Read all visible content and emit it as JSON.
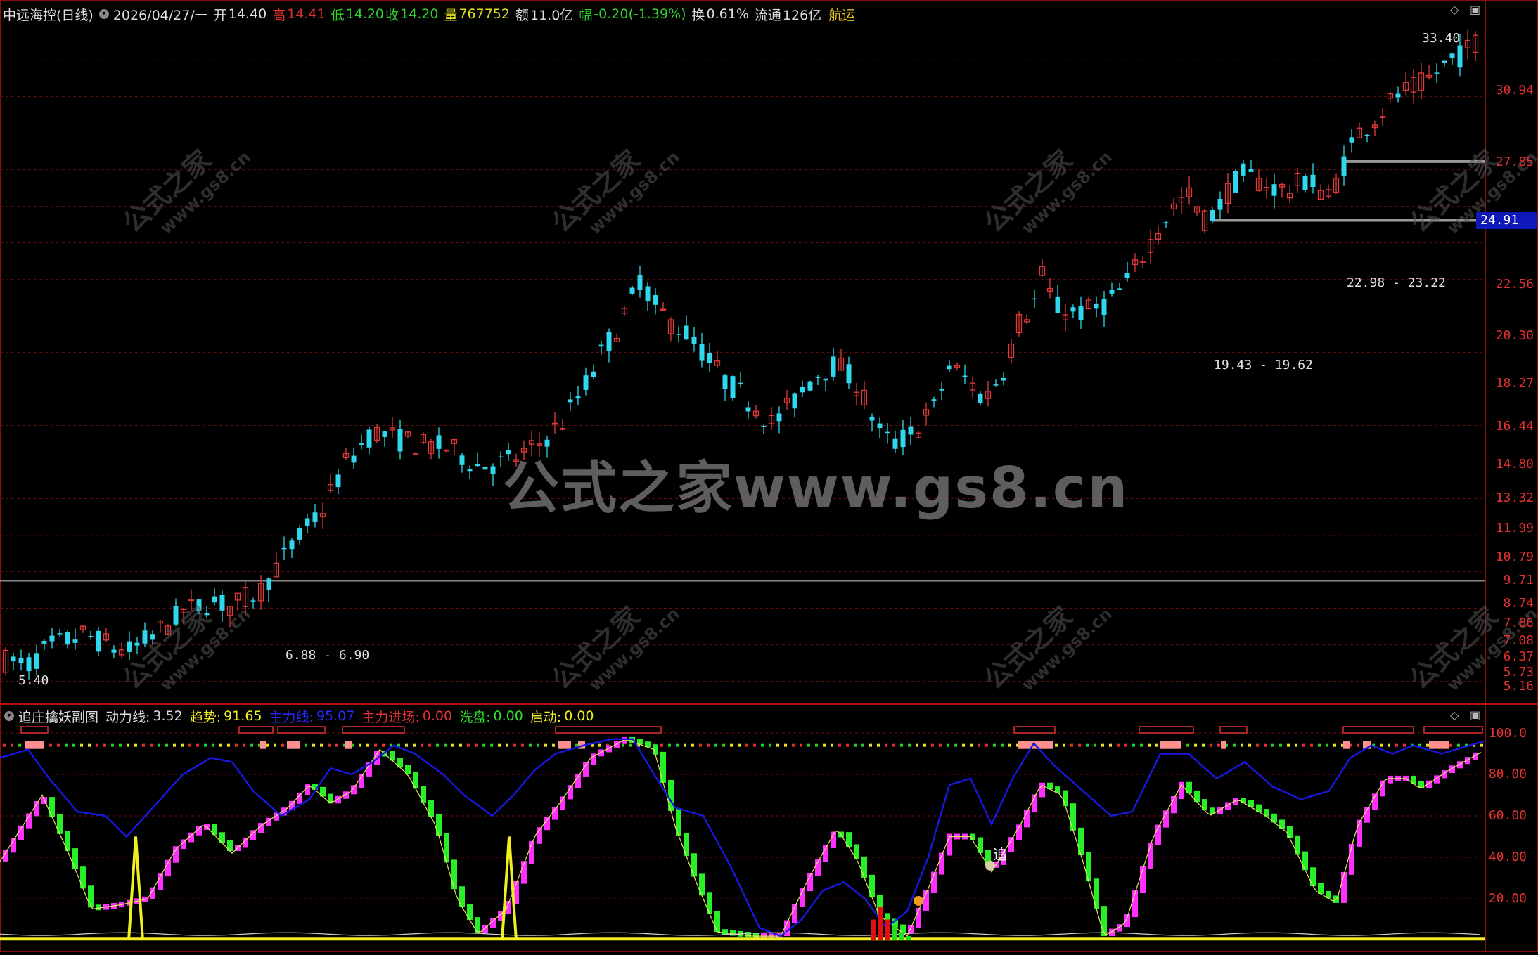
{
  "header": {
    "title": "中远海控(日线)",
    "date": "2026/04/27/一",
    "open_label": "开",
    "open": "14.40",
    "high_label": "高",
    "high": "14.41",
    "low_label": "低",
    "low": "14.20",
    "close_label": "收",
    "close": "14.20",
    "volume_label": "量",
    "volume": "767752",
    "amount_label": "额",
    "amount": "11.0亿",
    "change_label": "幅",
    "change": "-0.20(-1.39%)",
    "turnover_label": "换",
    "turnover": "0.61%",
    "float_label": "流通",
    "float": "126亿",
    "sector": "航运"
  },
  "watermark": {
    "main": "公式之家www.gs8.cn",
    "small_cn": "公式之家",
    "small_url": "www.gs8.cn"
  },
  "price_axis": {
    "labels": [
      "30.94",
      "27.85",
      "22.56",
      "20.30",
      "18.27",
      "16.44",
      "14.80",
      "13.32",
      "11.99",
      "10.79",
      "9.71",
      "8.74",
      "7.86",
      "7.08",
      "6.37",
      "5.73",
      "5.16"
    ],
    "current": "24.91"
  },
  "price_annotations": {
    "peak": "33.40",
    "low": "5.40",
    "zone1": "6.88 - 6.90",
    "zone2": "19.43 - 19.62",
    "zone3": "22.98 - 23.22"
  },
  "indicator": {
    "name": "追庄擒妖副图",
    "dong_label": "动力线:",
    "dong": "3.52",
    "trend_label": "趋势:",
    "trend": "91.65",
    "main_label": "主力线:",
    "main": "95.07",
    "enter_label": "主力进场:",
    "enter": "0.00",
    "wash_label": "洗盘:",
    "wash": "0.00",
    "start_label": "启动:",
    "start": "0.00",
    "axis": [
      "100.0",
      "80.00",
      "60.00",
      "40.00",
      "20.00"
    ],
    "chase_mark": "追"
  },
  "colors": {
    "up": "#e03a3a",
    "down": "#30d8ee",
    "main_line": "#1818e0",
    "trend_up": "#ff30ff",
    "trend_down": "#28f028",
    "yellow": "#f0f020",
    "grid": "#6a0c0c"
  }
}
